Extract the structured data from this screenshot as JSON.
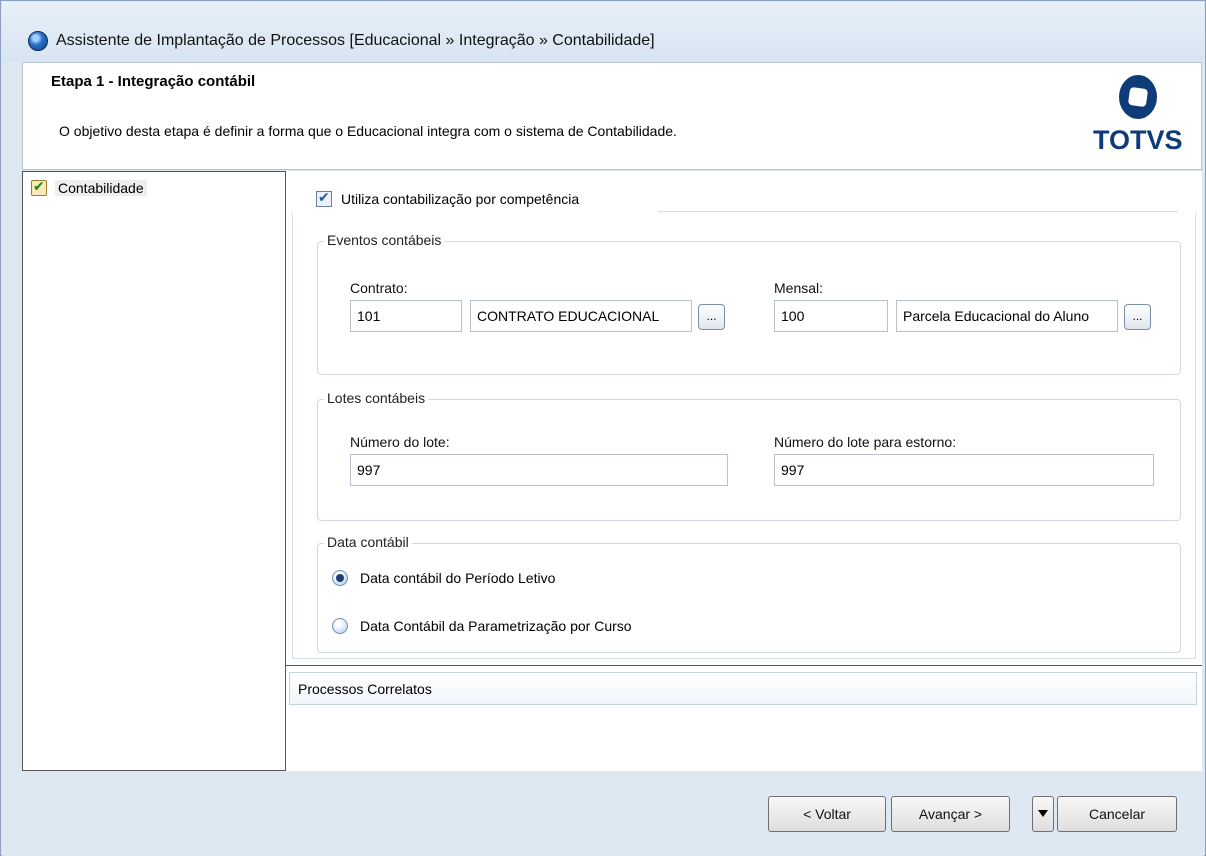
{
  "window": {
    "title": "Assistente de Implantação de Processos [Educacional » Integração » Contabilidade]"
  },
  "header": {
    "step_title": "Etapa 1 - Integração contábil",
    "description": "O objetivo desta etapa é definir a forma que o Educacional integra com o sistema de Contabilidade.",
    "logo_text": "TOTVS"
  },
  "tree": {
    "items": [
      {
        "label": "Contabilidade",
        "icon": "checklist-icon"
      }
    ]
  },
  "form": {
    "competencia_checkbox": {
      "label": "Utiliza contabilização por competência",
      "checked": true
    },
    "eventos": {
      "legend": "Eventos contábeis",
      "contrato_label": "Contrato:",
      "contrato_code": "101",
      "contrato_desc": "CONTRATO EDUCACIONAL",
      "mensal_label": "Mensal:",
      "mensal_code": "100",
      "mensal_desc": "Parcela Educacional do Aluno",
      "lookup_label": "..."
    },
    "lotes": {
      "legend": "Lotes contábeis",
      "numero_label": "Número do lote:",
      "numero_value": "997",
      "estorno_label": "Número do lote para estorno:",
      "estorno_value": "997"
    },
    "data": {
      "legend": "Data contábil",
      "options": [
        {
          "label": "Data contábil do Período Letivo",
          "selected": true
        },
        {
          "label": "Data Contábil da Parametrização por Curso",
          "selected": false
        }
      ]
    }
  },
  "correlatos": {
    "title": "Processos Correlatos"
  },
  "footer": {
    "back_label": "< Voltar",
    "next_label": "Avançar >",
    "cancel_label": "Cancelar"
  }
}
